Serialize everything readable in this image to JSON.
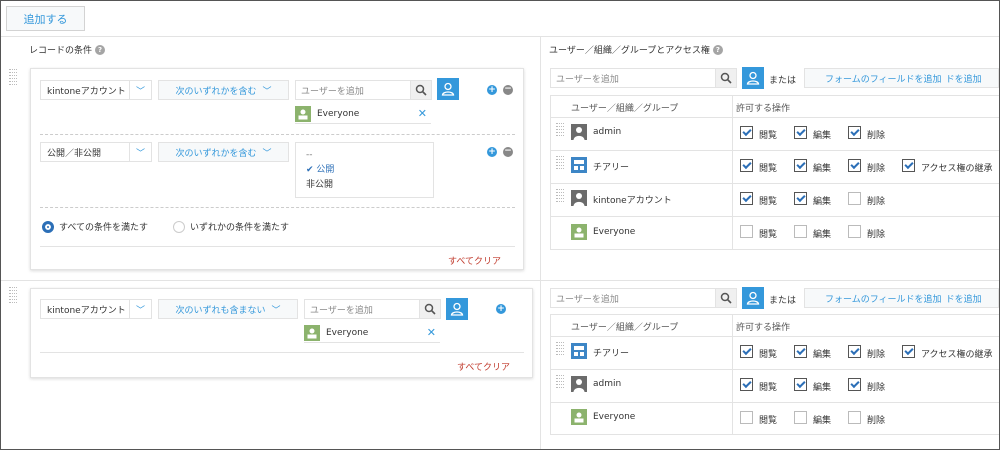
{
  "toolbar": {
    "add_label": "追加する"
  },
  "left_header": {
    "title": "レコードの条件",
    "help": "?"
  },
  "right_header": {
    "title": "ユーザー／組織／グループとアクセス権",
    "help": "?"
  },
  "rule1": {
    "cond1": {
      "field": "kintoneアカウント",
      "operator": "次のいずれかを含む",
      "user_placeholder": "ユーザーを追加",
      "chip": "Everyone"
    },
    "cond2": {
      "field": "公開／非公開",
      "operator": "次のいずれかを含む",
      "options": [
        "--",
        "公開",
        "非公開"
      ],
      "selected": "公開"
    },
    "match_all": "すべての条件を満たす",
    "match_any": "いずれかの条件を満たす",
    "clear": "すべてクリア",
    "access": {
      "search_placeholder": "ユーザーを追加",
      "or": "または",
      "field_button": "フォームのフィールドを追加",
      "field_button_tail": "ドを追加",
      "col_entity": "ユーザー／組織／グループ",
      "col_perm": "許可する操作",
      "rows": [
        {
          "name": "admin",
          "view": "閲覧",
          "edit": "編集",
          "delete": "削除"
        },
        {
          "name": "チアリー",
          "view": "閲覧",
          "edit": "編集",
          "delete": "削除",
          "manage": "アクセス権の継承"
        },
        {
          "name": "kintoneアカウント",
          "view": "閲覧",
          "edit": "編集",
          "delete": "削除"
        },
        {
          "name": "Everyone",
          "view": "閲覧",
          "edit": "編集",
          "delete": "削除"
        }
      ]
    }
  },
  "rule2": {
    "cond1": {
      "field": "kintoneアカウント",
      "operator": "次のいずれも含まない",
      "user_placeholder": "ユーザーを追加",
      "chip": "Everyone"
    },
    "clear": "すべてクリア",
    "access": {
      "search_placeholder": "ユーザーを追加",
      "or": "または",
      "field_button": "フォームのフィールドを追加",
      "field_button_tail": "ドを追加",
      "col_entity": "ユーザー／組織／グループ",
      "col_perm": "許可する操作",
      "rows": [
        {
          "name": "チアリー",
          "view": "閲覧",
          "edit": "編集",
          "delete": "削除",
          "manage": "アクセス権の継承"
        },
        {
          "name": "admin",
          "view": "閲覧",
          "edit": "編集",
          "delete": "削除"
        },
        {
          "name": "Everyone",
          "view": "閲覧",
          "edit": "編集",
          "delete": "削除"
        }
      ]
    }
  },
  "colors": {
    "accent": "#3498db",
    "clear": "#c0392b",
    "check": "#2c6fb7"
  }
}
